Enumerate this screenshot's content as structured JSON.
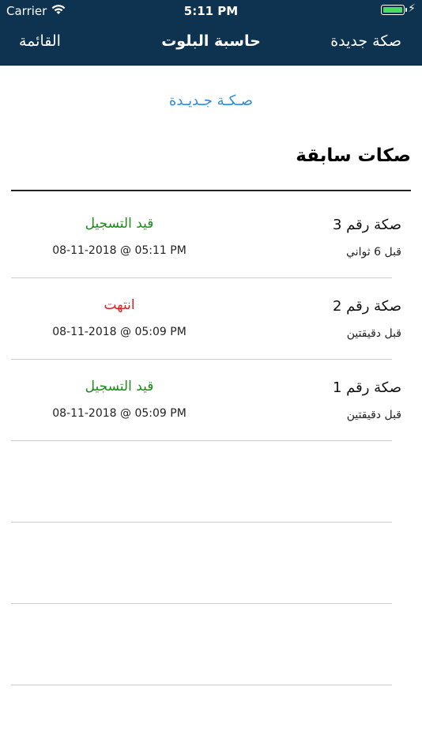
{
  "status_bar": {
    "carrier": "Carrier",
    "time": "5:11 PM"
  },
  "nav": {
    "left": "القائمة",
    "title": "حاسبة البلوت",
    "right": "صكة جديدة"
  },
  "new_game_link": "صـكـة جـديـدة",
  "section_title": "صكات سابقة",
  "games": [
    {
      "name": "صكة رقم 3",
      "ago": "قبل 6 ثواني",
      "status": "قيد التسجيل",
      "status_color": "#1a8c1a",
      "date": "08-11-2018 @ 05:11 PM"
    },
    {
      "name": "صكة رقم 2",
      "ago": "قبل دقيقتين",
      "status": "انتهت",
      "status_color": "#e02020",
      "date": "08-11-2018 @ 05:09 PM"
    },
    {
      "name": "صكة رقم 1",
      "ago": "قبل دقيقتين",
      "status": "قيد التسجيل",
      "status_color": "#1a8c1a",
      "date": "08-11-2018 @ 05:09 PM"
    }
  ],
  "icons": {
    "wifi": "wifi-icon",
    "battery": "battery-icon",
    "charging": "charging-bolt-icon"
  }
}
